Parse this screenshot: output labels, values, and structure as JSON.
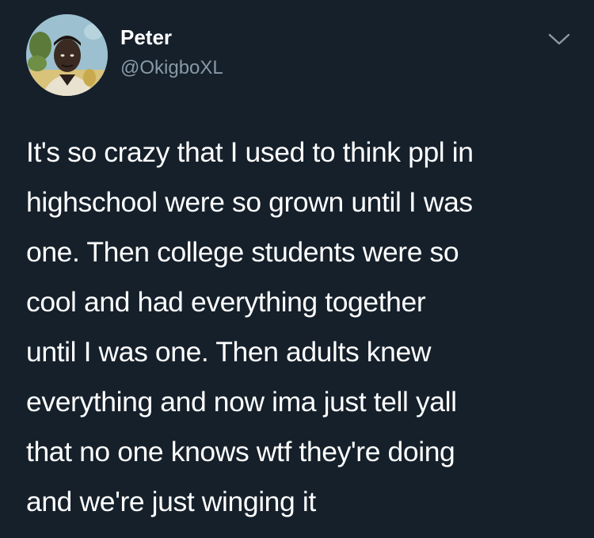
{
  "author": {
    "display_name": "Peter",
    "handle": "@OkigboXL",
    "avatar_icon": "profile-photo"
  },
  "menu": {
    "icon": "chevron-down-icon"
  },
  "tweet": {
    "lines": [
      "It's so crazy that I used to think ppl in",
      "highschool were so grown until I was",
      "one. Then college students were so",
      "cool and had everything together",
      "until I was one. Then adults knew",
      "everything and now ima just tell yall",
      "that no one knows wtf they're doing",
      "and we're just winging it"
    ]
  },
  "colors": {
    "background": "#15202b",
    "text": "#ffffff",
    "secondary_text": "#8899a6"
  }
}
